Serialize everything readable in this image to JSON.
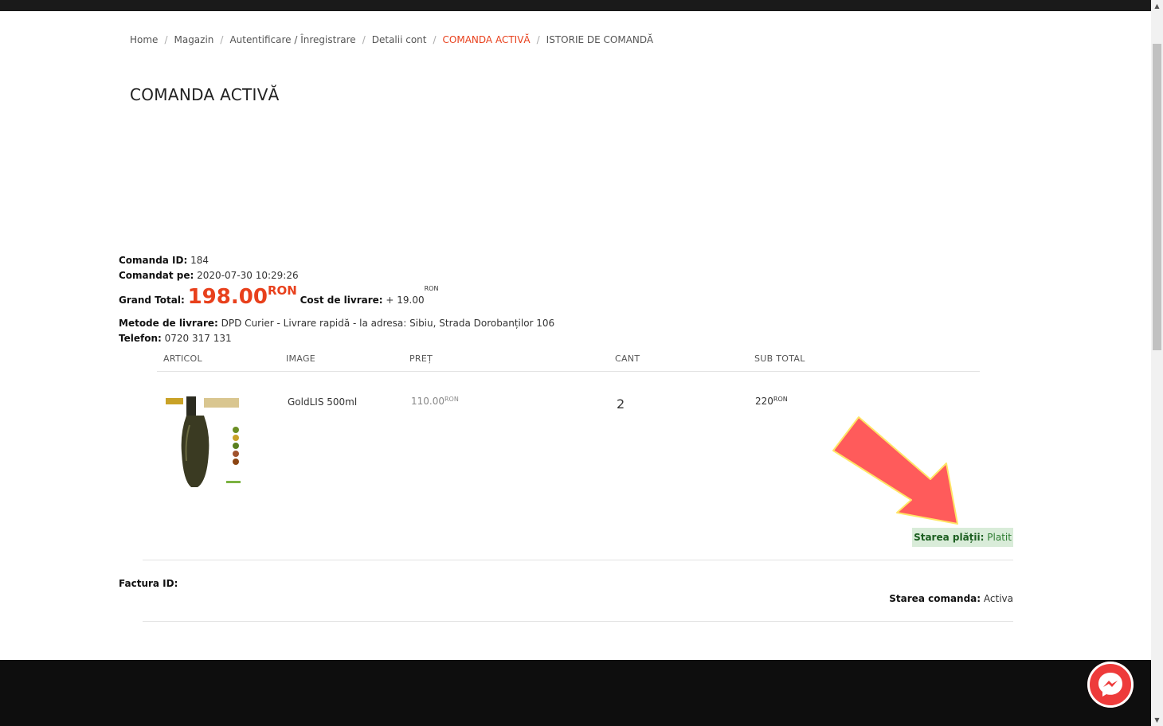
{
  "breadcrumb": {
    "items": [
      "Home",
      "Magazin",
      "Autentificare / Înregistrare",
      "Detalii cont",
      "COMANDA ACTIVĂ",
      "ISTORIE DE COMANDĂ"
    ],
    "separator": "/"
  },
  "page": {
    "title": "COMANDA ACTIVĂ"
  },
  "order": {
    "id_label": "Comanda ID:",
    "id_value": "184",
    "date_label": "Comandat pe:",
    "date_value": "2020-07-30 10:29:26",
    "grand_total_label": "Grand Total:",
    "grand_total_value": "198.00",
    "currency": "RON",
    "shipping_label": "Cost de livrare:",
    "shipping_value": "+ 19.00",
    "delivery_label": "Metode de livrare:",
    "delivery_value": "DPD Curier - Livrare rapidă - la adresa: Sibiu, Strada Dorobanților 106",
    "phone_label": "Telefon:",
    "phone_value": "0720 317 131"
  },
  "table": {
    "headers": [
      "ARTICOL",
      "IMAGE",
      "PREȚ",
      "CANT",
      "SUB TOTAL"
    ],
    "rows": [
      {
        "name": "GoldLIS 500ml",
        "price": "110.00",
        "qty": "2",
        "subtotal": "220",
        "currency": "RON"
      }
    ]
  },
  "payment": {
    "label": "Starea plății:",
    "value": "Platit"
  },
  "invoice": {
    "label": "Factura ID:",
    "value": ""
  },
  "status": {
    "label": "Starea comanda:",
    "value": "Activa"
  },
  "colors": {
    "accent": "#e8401c",
    "paid_bg": "#d9ecd9",
    "arrow": "#ff5b5b",
    "messenger": "#ee3b3b"
  },
  "icons": {
    "chat": "messenger-icon",
    "arrow": "red-arrow-annotation"
  }
}
